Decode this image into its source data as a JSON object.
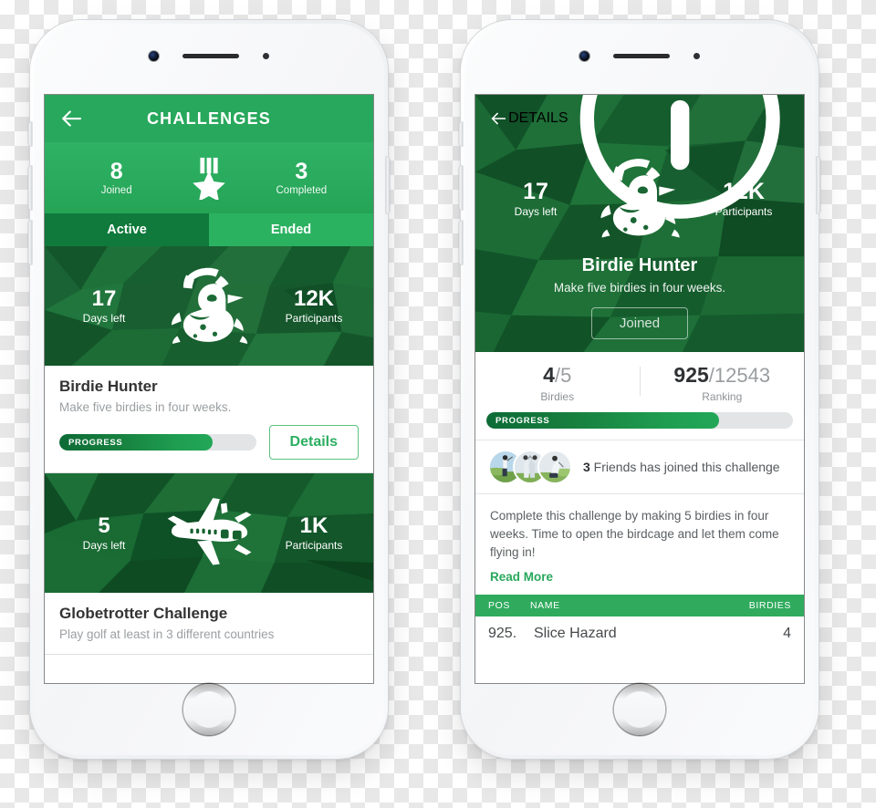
{
  "colors": {
    "brand_green": "#28a85c",
    "dark_green": "#0f7a3b",
    "light_green": "#2bb261",
    "hero_green": "#1d6b37",
    "text_dark": "#333333",
    "text_muted": "#9b9fa2"
  },
  "left_phone": {
    "appbar": {
      "back_icon": "arrow-left-icon",
      "title": "CHALLENGES"
    },
    "stats": [
      {
        "num": "8",
        "label": "Joined"
      },
      {
        "num": "3",
        "label": "Completed"
      }
    ],
    "medal_icon": "medal-star-icon",
    "tabs": [
      {
        "label": "Active",
        "selected": true
      },
      {
        "label": "Ended",
        "selected": false
      }
    ],
    "cards": [
      {
        "icon": "duck-hatching-icon",
        "days_left_value": "17",
        "days_left_label": "Days left",
        "participants_value": "12K",
        "participants_label": "Participants",
        "title": "Birdie Hunter",
        "subtitle": "Make five birdies in four weeks.",
        "progress_label": "PROGRESS",
        "progress_percent": 78,
        "button_label": "Details"
      },
      {
        "icon": "airplane-icon",
        "days_left_value": "5",
        "days_left_label": "Days left",
        "participants_value": "1K",
        "participants_label": "Participants",
        "title": "Globetrotter Challenge",
        "subtitle": "Play golf at least in 3 different countries"
      }
    ]
  },
  "right_phone": {
    "appbar": {
      "back_icon": "arrow-left-icon",
      "title": "DETAILS",
      "info_icon": "info-circle-icon"
    },
    "hero": {
      "icon": "duck-hatching-icon",
      "days_left_value": "17",
      "days_left_label": "Days left",
      "participants_value": "12K",
      "participants_label": "Participants",
      "title": "Birdie Hunter",
      "subtitle": "Make five birdies in four weeks.",
      "joined_label": "Joined"
    },
    "stats": {
      "birdies_current": "4",
      "birdies_total": "/5",
      "birdies_label": "Birdies",
      "ranking_current": "925",
      "ranking_total": "/12543",
      "ranking_label": "Ranking"
    },
    "progress": {
      "label": "PROGRESS",
      "percent": 76
    },
    "friends": {
      "count": "3",
      "text": " Friends has joined this challenge",
      "avatar_count": 3
    },
    "about": {
      "text": "Complete this challenge by making 5 birdies in four weeks. Time to open the birdcage and let them come flying in!",
      "read_more": "Read More"
    },
    "leaderboard": {
      "headers": {
        "pos": "POS",
        "name": "NAME",
        "birdies": "BIRDIES"
      },
      "rows": [
        {
          "pos": "925.",
          "name": "Slice Hazard",
          "birdies": "4"
        }
      ]
    }
  }
}
